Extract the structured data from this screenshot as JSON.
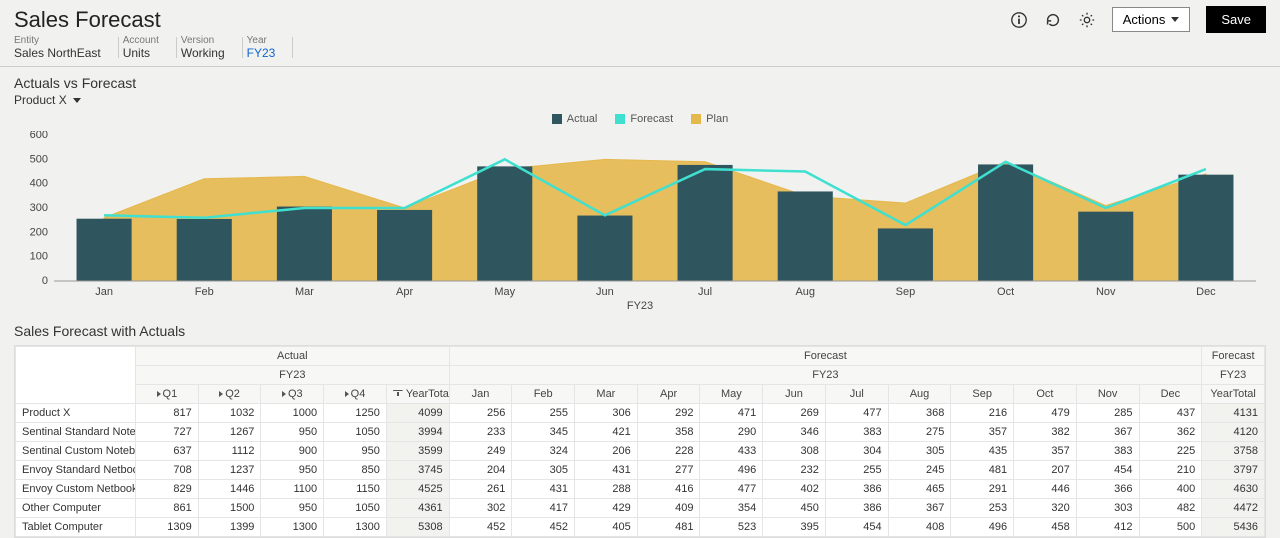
{
  "header": {
    "title": "Sales Forecast",
    "actions_label": "Actions",
    "save_label": "Save"
  },
  "pov": {
    "entity_label": "Entity",
    "entity_value": "Sales NorthEast",
    "account_label": "Account",
    "account_value": "Units",
    "version_label": "Version",
    "version_value": "Working",
    "year_label": "Year",
    "year_value": "FY23"
  },
  "chart_section": {
    "title": "Actuals vs Forecast",
    "product": "Product X",
    "legend": {
      "actual": "Actual",
      "forecast": "Forecast",
      "plan": "Plan"
    }
  },
  "chart_data": {
    "type": "bar+line+area",
    "categories": [
      "Jan",
      "Feb",
      "Mar",
      "Apr",
      "May",
      "Jun",
      "Jul",
      "Aug",
      "Sep",
      "Oct",
      "Nov",
      "Dec"
    ],
    "series": [
      {
        "name": "Actual",
        "kind": "bar",
        "values": [
          256,
          255,
          306,
          292,
          471,
          269,
          477,
          368,
          216,
          479,
          285,
          437
        ]
      },
      {
        "name": "Forecast",
        "kind": "line",
        "values": [
          270,
          260,
          300,
          300,
          500,
          270,
          460,
          450,
          230,
          490,
          300,
          460
        ]
      },
      {
        "name": "Plan",
        "kind": "area",
        "values": [
          260,
          420,
          430,
          300,
          460,
          500,
          490,
          350,
          320,
          490,
          310,
          440
        ]
      }
    ],
    "title": "Actuals vs Forecast",
    "xlabel": "FY23",
    "ylabel": "",
    "ylim": [
      0,
      600
    ],
    "yticks": [
      0,
      100,
      200,
      300,
      400,
      500,
      600
    ]
  },
  "grid_section": {
    "title": "Sales Forecast with Actuals"
  },
  "grid": {
    "top_headers": {
      "actual": "Actual",
      "forecast": "Forecast",
      "forecast_total": "Forecast"
    },
    "year_header": "FY23",
    "quarters": [
      "Q1",
      "Q2",
      "Q3",
      "Q4"
    ],
    "year_total_label": "YearTotal",
    "months": [
      "Jan",
      "Feb",
      "Mar",
      "Apr",
      "May",
      "Jun",
      "Jul",
      "Aug",
      "Sep",
      "Oct",
      "Nov",
      "Dec"
    ],
    "rows": [
      {
        "label": "Product X",
        "actual": [
          817,
          1032,
          1000,
          1250,
          4099
        ],
        "forecast": [
          256,
          255,
          306,
          292,
          471,
          269,
          477,
          368,
          216,
          479,
          285,
          437
        ],
        "ftotal": 4131
      },
      {
        "label": "Sentinal Standard Notebook",
        "actual": [
          727,
          1267,
          950,
          1050,
          3994
        ],
        "forecast": [
          233,
          345,
          421,
          358,
          290,
          346,
          383,
          275,
          357,
          382,
          367,
          362
        ],
        "ftotal": 4120
      },
      {
        "label": "Sentinal Custom Notebook",
        "actual": [
          637,
          1112,
          900,
          950,
          3599
        ],
        "forecast": [
          249,
          324,
          206,
          228,
          433,
          308,
          304,
          305,
          435,
          357,
          383,
          225
        ],
        "ftotal": 3758
      },
      {
        "label": "Envoy Standard Netbook",
        "actual": [
          708,
          1237,
          950,
          850,
          3745
        ],
        "forecast": [
          204,
          305,
          431,
          277,
          496,
          232,
          255,
          245,
          481,
          207,
          454,
          210
        ],
        "ftotal": 3797
      },
      {
        "label": "Envoy Custom Netbook",
        "actual": [
          829,
          1446,
          1100,
          1150,
          4525
        ],
        "forecast": [
          261,
          431,
          288,
          416,
          477,
          402,
          386,
          465,
          291,
          446,
          366,
          400
        ],
        "ftotal": 4630
      },
      {
        "label": "Other Computer",
        "actual": [
          861,
          1500,
          950,
          1050,
          4361
        ],
        "forecast": [
          302,
          417,
          429,
          409,
          354,
          450,
          386,
          367,
          253,
          320,
          303,
          482
        ],
        "ftotal": 4472
      },
      {
        "label": "Tablet Computer",
        "actual": [
          1309,
          1399,
          1300,
          1300,
          5308
        ],
        "forecast": [
          452,
          452,
          405,
          481,
          523,
          395,
          454,
          408,
          496,
          458,
          412,
          500
        ],
        "ftotal": 5436
      }
    ]
  }
}
